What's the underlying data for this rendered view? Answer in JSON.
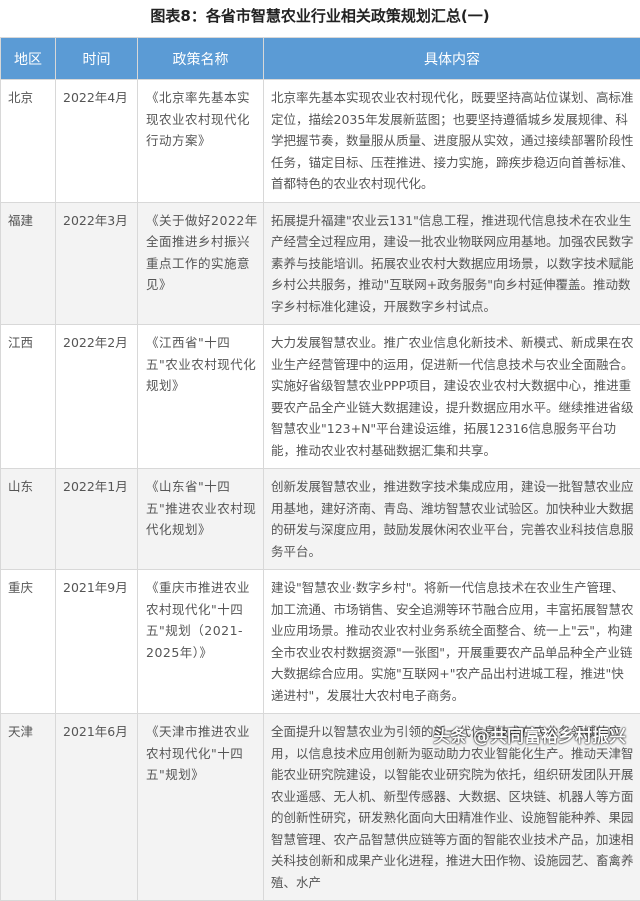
{
  "title": "图表8：各省市智慧农业行业相关政策规划汇总(一)",
  "headers": [
    "地区",
    "时间",
    "政策名称",
    "具体内容"
  ],
  "rows": [
    {
      "region": "北京",
      "time": "2022年4月",
      "policy": "《北京率先基本实现农业农村现代化行动方案》",
      "content": "北京率先基本实现农业农村现代化，既要坚持高站位谋划、高标准定位，描绘2035年发展新蓝图；也要坚持遵循城乡发展规律、科学把握节奏，数量服从质量、进度服从实效，通过接续部署阶段性任务，锚定目标、压茬推进、接力实施，蹄疾步稳迈向首善标准、首都特色的农业农村现代化。"
    },
    {
      "region": "福建",
      "time": "2022年3月",
      "policy": "《关于做好2022年全面推进乡村振兴重点工作的实施意见》",
      "content": "拓展提升福建\"农业云131\"信息工程，推进现代信息技术在农业生产经营全过程应用，建设一批农业物联网应用基地。加强农民数字素养与技能培训。拓展农业农村大数据应用场景，以数字技术赋能乡村公共服务，推动\"互联网+政务服务\"向乡村延伸覆盖。推动数字乡村标准化建设，开展数字乡村试点。"
    },
    {
      "region": "江西",
      "time": "2022年2月",
      "policy": "《江西省\"十四五\"农业农村现代化规划》",
      "content": "大力发展智慧农业。推广农业信息化新技术、新模式、新成果在农业生产经营管理中的运用，促进新一代信息技术与农业全面融合。实施好省级智慧农业PPP项目，建设农业农村大数据中心，推进重要农产品全产业链大数据建设，提升数据应用水平。继续推进省级智慧农业\"123+N\"平台建设运维，拓展12316信息服务平台功能，推动农业农村基础数据汇集和共享。"
    },
    {
      "region": "山东",
      "time": "2022年1月",
      "policy": "《山东省\"十四五\"推进农业农村现代化规划》",
      "content": "创新发展智慧农业，推进数字技术集成应用，建设一批智慧农业应用基地，建好济南、青岛、潍坊智慧农业试验区。加快种业大数据的研发与深度应用，鼓励发展休闲农业平台，完善农业科技信息服务平台。"
    },
    {
      "region": "重庆",
      "time": "2021年9月",
      "policy": "《重庆市推进农业农村现代化\"十四五\"规划（2021-2025年）》",
      "content": "建设\"智慧农业·数字乡村\"。将新一代信息技术在农业生产管理、加工流通、市场销售、安全追溯等环节融合应用，丰富拓展智慧农业应用场景。推动农业农村业务系统全面整合、统一上\"云\"，构建全市农业农村数据资源\"一张图\"，开展重要农产品单品种全产业链大数据综合应用。实施\"互联网+\"农产品出村进城工程，推进\"快递进村\"，发展壮大农村电子商务。"
    },
    {
      "region": "天津",
      "time": "2021年6月",
      "policy": "《天津市推进农业农村现代化\"十四五\"规划》",
      "content": "全面提升以智慧农业为引领的新一代信息技术在农业各领域的应用，以信息技术应用创新为驱动助力农业智能化生产。推动天津智能农业研究院建设，以智能农业研究院为依托，组织研发团队开展农业遥感、无人机、新型传感器、大数据、区块链、机器人等方面的创新性研究，研发熟化面向大田精准作业、设施智能种养、果园智慧管理、农产品智慧供应链等方面的智能农业技术产品，加速相关科技创新和成果产业化进程，推进大田作物、设施园艺、畜禽养殖、水产"
    }
  ],
  "watermark": "头条 @共同富裕乡村振兴"
}
